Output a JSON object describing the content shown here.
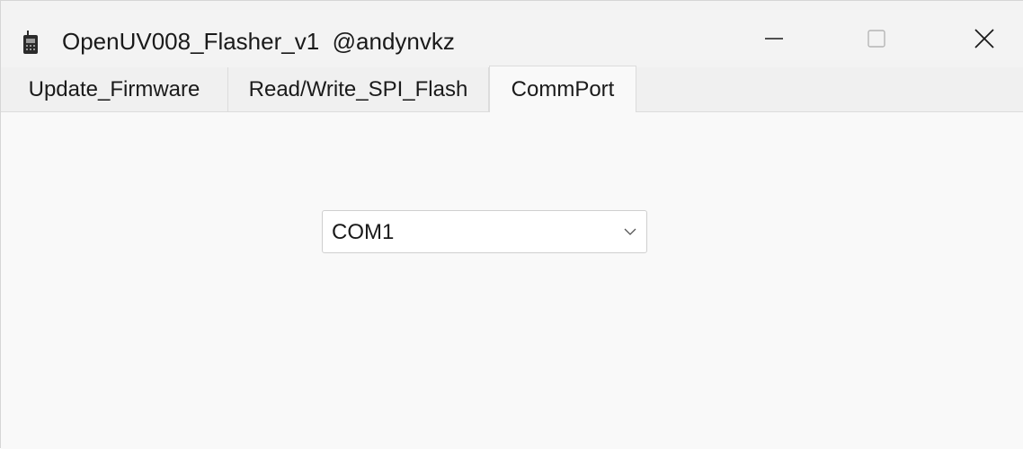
{
  "window": {
    "title": "OpenUV008_Flasher_v1  @andynvkz",
    "app_icon": "radio-icon",
    "controls": {
      "minimize_icon": "minimize-icon",
      "maximize_icon": "maximize-icon",
      "close_icon": "close-icon"
    }
  },
  "tabs": [
    {
      "label": "Update_Firmware",
      "active": false
    },
    {
      "label": "Read/Write_SPI_Flash",
      "active": false
    },
    {
      "label": "CommPort",
      "active": true
    }
  ],
  "commport": {
    "selected_port": "COM1",
    "dropdown_icon": "chevron-down-icon"
  }
}
